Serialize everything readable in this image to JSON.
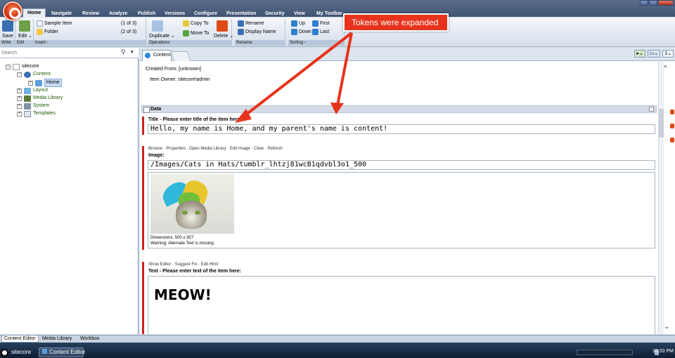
{
  "menu": {
    "tabs": [
      "Home",
      "Navigate",
      "Review",
      "Analyze",
      "Publish",
      "Versions",
      "Configure",
      "Presentation",
      "Security",
      "View",
      "My Toolbar"
    ],
    "active_tab": "Home"
  },
  "ribbon": {
    "write_label": "Write",
    "edit_label": "Edit",
    "insert_label": "Insert",
    "operations_label": "Operations",
    "rename_label": "Rename",
    "sorting_label": "Sorting",
    "save": "Save",
    "edit": "Edit",
    "sample_item": "Sample Item",
    "sample_item_count": "(1 of 3)",
    "folder": "Folder",
    "folder_count": "(2 of 3)",
    "duplicate": "Duplicate",
    "copy_to": "Copy To",
    "move_to": "Move To",
    "delete": "Delete",
    "rename": "Rename",
    "display_name": "Display Name",
    "up": "Up",
    "down": "Down",
    "first": "First",
    "last": "Last"
  },
  "callout": {
    "text": "Tokens were expanded"
  },
  "search": {
    "placeholder": "Search"
  },
  "tree": {
    "root": "sitecore",
    "content": "Content",
    "home": "Home",
    "layout": "Layout",
    "media_library": "Media Library",
    "system": "System",
    "templates": "Templates"
  },
  "content_tab": {
    "label": "Content"
  },
  "meta": {
    "created_from_label": "Created From:",
    "created_from_value": "[unknown]",
    "owner_label": "Item Owner:",
    "owner_value": "sitecore\\admin"
  },
  "section": {
    "title": "Data"
  },
  "title_field": {
    "label": "Title - Please enter title of the item here:",
    "value": "Hello, my name is Home, and my parent's name is content!"
  },
  "image_field": {
    "links": "Browse · Properties · Open Media Library · Edit Image · Clear · Refresh",
    "label": "Image:",
    "path": "/Images/Cats in Hats/tumblr_lhtzj81wcB1qdvbl3o1_500",
    "dimensions": "Dimensions: 500 x 357",
    "warning": "Warning: Alternate Text is missing."
  },
  "text_field": {
    "links": "Show Editor · Suggest Fix · Edit Html",
    "label": "Text - Please enter text of the item here:",
    "value": "MEOW!"
  },
  "bottom_tabs": [
    "Content Editor",
    "Media Library",
    "Workbox"
  ],
  "taskbar": {
    "app1": "sitecore",
    "app2": "Content Editor",
    "clock": "10:33 PM"
  },
  "colors": {
    "callout": "#e8331c",
    "accent_red": "#cc2222",
    "ribbon_label": "#b7c6da"
  },
  "icons": [
    "save-icon",
    "edit-icon",
    "sample-item-icon",
    "folder-icon",
    "duplicate-icon",
    "copy-icon",
    "delete-icon",
    "rename-icon",
    "display-name-icon",
    "up-arrow-icon",
    "down-arrow-icon",
    "first-icon",
    "last-icon",
    "search-icon",
    "dropdown-icon"
  ]
}
